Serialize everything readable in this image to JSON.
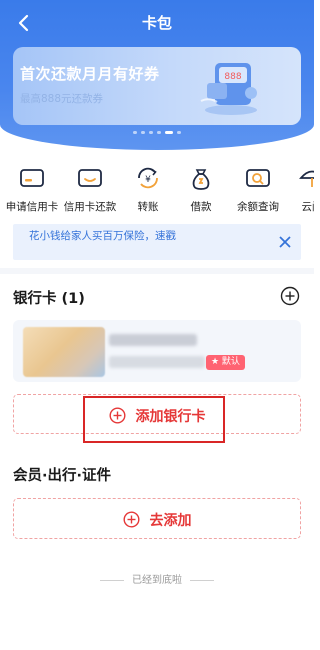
{
  "header": {
    "title": "卡包",
    "back_icon": "back-arrow-icon",
    "color": "#3a7bea"
  },
  "banner": {
    "title": "首次还款月月有好券",
    "subtitle": "最高888元还款券",
    "art_text": "888",
    "active_dot": 5,
    "dot_count": 6
  },
  "functions": [
    {
      "label": "申请信用卡",
      "icon": "credit-card-icon"
    },
    {
      "label": "信用卡还款",
      "icon": "card-repay-icon"
    },
    {
      "label": "转账",
      "icon": "transfer-icon"
    },
    {
      "label": "借款",
      "icon": "money-bag-icon"
    },
    {
      "label": "余额查询",
      "icon": "balance-search-icon"
    },
    {
      "label": "云闪",
      "icon": "umbrella-icon"
    }
  ],
  "notice": {
    "text": "花小钱给家人买百万保险，速戳",
    "close_icon": "close-icon"
  },
  "bank_section": {
    "title": "银行卡 (1)",
    "default_badge": "★ 默认"
  },
  "add_bank_card": {
    "label": "添加银行卡"
  },
  "member_section": {
    "title": "会员·出行·证件",
    "add_label": "去添加"
  },
  "footer": {
    "text": "已经到底啦"
  },
  "colors": {
    "accent_red": "#e53838",
    "accent_blue": "#3573d9"
  }
}
